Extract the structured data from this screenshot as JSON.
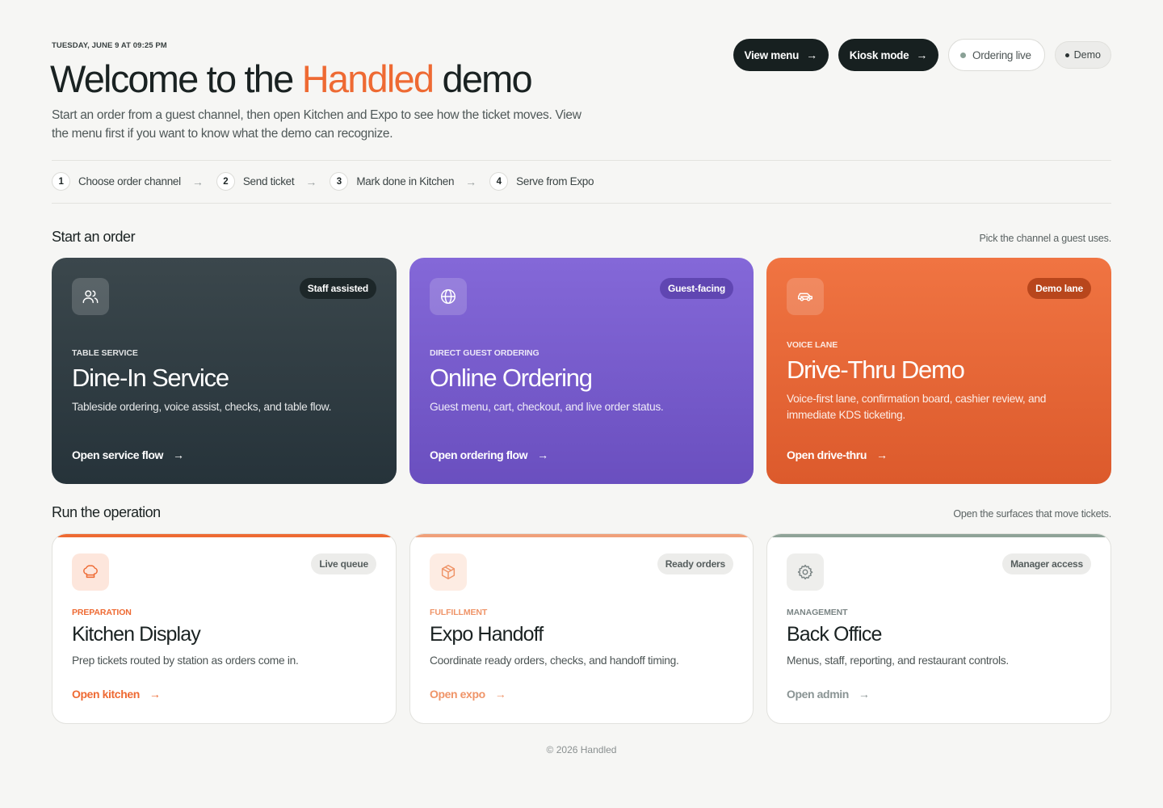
{
  "header": {
    "datestamp": "TUESDAY, JUNE 9 AT 09:25 PM",
    "title_before": "Welcome to the ",
    "title_accent": "Handled",
    "title_after": " demo",
    "subtitle": "Start an order from a guest channel, then open Kitchen and Expo to see how the ticket moves. View the menu first if you want to know what the demo can recognize.",
    "actions": {
      "view_menu": "View menu",
      "kiosk_mode": "Kiosk mode",
      "ordering_live": "Ordering live",
      "demo": "Demo"
    }
  },
  "steps": [
    {
      "num": "1",
      "label": "Choose order channel"
    },
    {
      "num": "2",
      "label": "Send ticket"
    },
    {
      "num": "3",
      "label": "Mark done in Kitchen"
    },
    {
      "num": "4",
      "label": "Serve from Expo"
    }
  ],
  "start_section": {
    "title": "Start an order",
    "hint": "Pick the channel a guest uses.",
    "cards": [
      {
        "badge": "Staff assisted",
        "eyebrow": "TABLE SERVICE",
        "title": "Dine-In Service",
        "desc": "Tableside ordering, voice assist, checks, and table flow.",
        "link": "Open service flow",
        "icon": "users-icon"
      },
      {
        "badge": "Guest-facing",
        "eyebrow": "DIRECT GUEST ORDERING",
        "title": "Online Ordering",
        "desc": "Guest menu, cart, checkout, and live order status.",
        "link": "Open ordering flow",
        "icon": "globe-icon"
      },
      {
        "badge": "Demo lane",
        "eyebrow": "VOICE LANE",
        "title": "Drive-Thru Demo",
        "desc": "Voice-first lane, confirmation board, cashier review, and immediate KDS ticketing.",
        "link": "Open drive-thru",
        "icon": "car-icon"
      }
    ]
  },
  "operation_section": {
    "title": "Run the operation",
    "hint": "Open the surfaces that move tickets.",
    "cards": [
      {
        "badge": "Live queue",
        "eyebrow": "PREPARATION",
        "title": "Kitchen Display",
        "desc": "Prep tickets routed by station as orders come in.",
        "link": "Open kitchen",
        "icon": "chef-hat-icon",
        "accent": "#ee6a33"
      },
      {
        "badge": "Ready orders",
        "eyebrow": "FULFILLMENT",
        "title": "Expo Handoff",
        "desc": "Coordinate ready orders, checks, and handoff timing.",
        "link": "Open expo",
        "icon": "box-icon",
        "accent": "#f0a07a"
      },
      {
        "badge": "Manager access",
        "eyebrow": "MANAGEMENT",
        "title": "Back Office",
        "desc": "Menus, staff, reporting, and restaurant controls.",
        "link": "Open admin",
        "icon": "gear-icon",
        "accent": "#8fa398"
      }
    ]
  },
  "footer": "© 2026 Handled",
  "colors": {
    "accent": "#ee6a33",
    "dark": "#172020",
    "purple": "#7a5dd0",
    "orange": "#e8683a"
  }
}
